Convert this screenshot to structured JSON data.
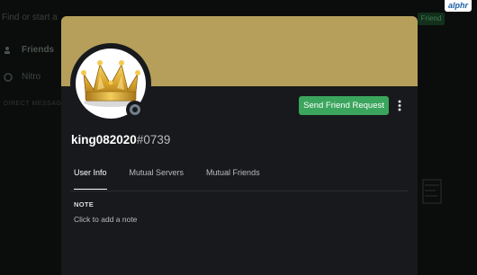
{
  "watermark": {
    "text": "alphr"
  },
  "background": {
    "search_text": "Find or start a",
    "nav": [
      {
        "label": "Friends"
      },
      {
        "label": "Nitro"
      }
    ],
    "dm_header": "DIRECT MESSAGES",
    "add_friend_label": "Friend"
  },
  "profile": {
    "username": "king082020",
    "discriminator": "#0739",
    "status": "offline",
    "banner_color": "#b59f5a",
    "accent_color": "#3ba55d",
    "avatar_icon": "crown-icon",
    "send_request_label": "Send Friend Request",
    "more_icon": "more-vertical-icon",
    "tabs": [
      {
        "label": "User Info",
        "active": true
      },
      {
        "label": "Mutual Servers",
        "active": false
      },
      {
        "label": "Mutual Friends",
        "active": false
      }
    ],
    "note": {
      "title": "NOTE",
      "placeholder": "Click to add a note"
    }
  }
}
